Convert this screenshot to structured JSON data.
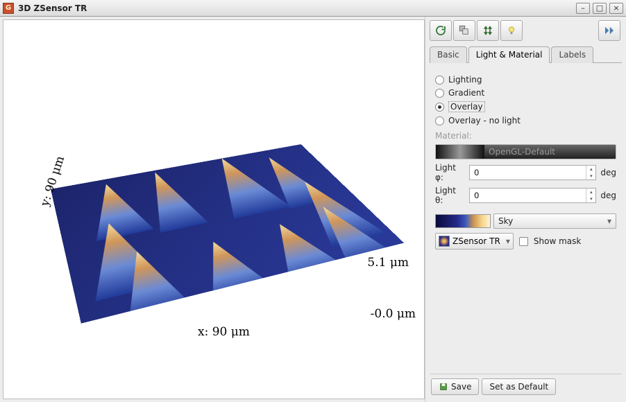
{
  "window": {
    "title": "3D ZSensor TR"
  },
  "tabs": {
    "basic": "Basic",
    "light_material": "Light & Material",
    "labels": "Labels",
    "active": "light_material"
  },
  "modes": {
    "lighting": "Lighting",
    "gradient": "Gradient",
    "overlay": "Overlay",
    "overlay_no_light": "Overlay - no light",
    "selected": "overlay"
  },
  "material": {
    "label": "Material:",
    "name": "OpenGL-Default"
  },
  "light_phi": {
    "label": "Light φ:",
    "value": "0",
    "unit": "deg"
  },
  "light_theta": {
    "label": "Light θ:",
    "value": "0",
    "unit": "deg"
  },
  "gradient": {
    "name": "Sky"
  },
  "source": {
    "name": "ZSensor TR"
  },
  "show_mask": {
    "label": "Show mask",
    "checked": false
  },
  "buttons": {
    "save": "Save",
    "set_default": "Set as Default"
  },
  "axes": {
    "x": "x: 90 μm",
    "y": "y: 90 μm",
    "z_max": "5.1 μm",
    "z_min": "-0.0 μm"
  }
}
